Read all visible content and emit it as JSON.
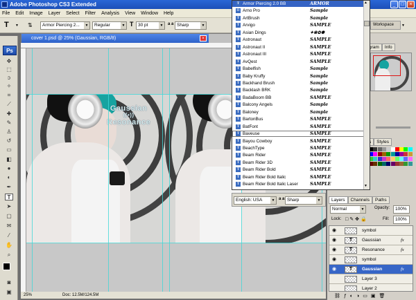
{
  "app": {
    "title": "Adobe Photoshop CS3 Extended",
    "window_buttons": [
      "_",
      "□",
      "×"
    ]
  },
  "menu": [
    "File",
    "Edit",
    "Image",
    "Layer",
    "Select",
    "Filter",
    "Analysis",
    "View",
    "Window",
    "Help"
  ],
  "options": {
    "tool_glyph": "T",
    "font_family": "Armor Piercing 2...",
    "font_style": "Regular",
    "size_icon": "T",
    "font_size": "30 pt",
    "aa_icon": "a a",
    "antialias": "Sharp",
    "workspace": "Workspace"
  },
  "document": {
    "tab_title": "cover 1.psd @ 25% (Gaussian, RGB/8)",
    "close": "×",
    "art_title_1": "Gaussian",
    "art_title_2": "Resonance",
    "zoom": "25%",
    "doc_info": "Doc: 12.5M/124.5M"
  },
  "font_list": [
    {
      "name": "Armor Piercing 2.0 BB",
      "sample": "ARMOR"
    },
    {
      "name": "Arno Pro",
      "sample": "Sample"
    },
    {
      "name": "ArtBrush",
      "sample": "Sample"
    },
    {
      "name": "Arvigo",
      "sample": "SAMPLE"
    },
    {
      "name": "Asian Dings",
      "sample": "✦❀✿✺"
    },
    {
      "name": "Astronaut",
      "sample": "SAMPLE"
    },
    {
      "name": "Astronaut II",
      "sample": "SAMPLE"
    },
    {
      "name": "Astronaut III",
      "sample": "SAMPLE"
    },
    {
      "name": "AvQest",
      "sample": "SAMPLE"
    },
    {
      "name": "Babelfish",
      "sample": "Sample"
    },
    {
      "name": "Baby Kruffy",
      "sample": "Sample"
    },
    {
      "name": "Backhand Brush",
      "sample": "Sample"
    },
    {
      "name": "Backlash BRK",
      "sample": "Sample"
    },
    {
      "name": "BadaBoom BB",
      "sample": "SAMPLE"
    },
    {
      "name": "Balcony Angels",
      "sample": "Sample"
    },
    {
      "name": "Baloney",
      "sample": "Sample"
    },
    {
      "name": "BartonBus",
      "sample": "SAMPLE"
    },
    {
      "name": "BatFont",
      "sample": "SAMPLE"
    },
    {
      "name": "Baveuse",
      "sample": "SAMPLE"
    },
    {
      "name": "Bayou Cowboy",
      "sample": "SAMPLE"
    },
    {
      "name": "BeachType",
      "sample": "SAMPLE"
    },
    {
      "name": "Beam Rider",
      "sample": "SAMPLE"
    },
    {
      "name": "Beam Rider 3D",
      "sample": "SAMPLE"
    },
    {
      "name": "Beam Rider Bold",
      "sample": "SAMPLE"
    },
    {
      "name": "Beam Rider Bold Italic",
      "sample": "SAMPLE"
    },
    {
      "name": "Beam Rider Bold Italic Laser",
      "sample": "SAMPLE"
    }
  ],
  "character": {
    "language": "English: USA",
    "aa_icon": "a a",
    "antialias": "Sharp"
  },
  "navigator": {
    "tabs": [
      "gram",
      "Info"
    ]
  },
  "swatches": {
    "tabs": [
      "s",
      "Styles"
    ]
  },
  "layers_panel": {
    "tabs": [
      "Layers",
      "Channels",
      "Paths"
    ],
    "blend_mode": "Normal",
    "opacity_label": "Opacity:",
    "opacity": "100%",
    "lock_label": "Lock:",
    "fill_label": "Fill:",
    "fill": "100%",
    "rows": [
      {
        "name": "symbol",
        "type": "",
        "fx": ""
      },
      {
        "name": "Gaussian",
        "type": "T",
        "fx": "fx"
      },
      {
        "name": "Resonance",
        "type": "T",
        "fx": "fx"
      },
      {
        "name": "symbol",
        "type": "",
        "fx": ""
      },
      {
        "name": "Gaussian",
        "type": "T",
        "fx": "fx"
      },
      {
        "name": "Layer 3",
        "type": "",
        "fx": ""
      },
      {
        "name": "Layer 2",
        "type": "",
        "fx": ""
      }
    ]
  },
  "colors": {
    "xp_blue": "#2a67d6",
    "highlight": "#3563c4",
    "teal": "#41d7d7",
    "hair": "#16a3a0"
  }
}
